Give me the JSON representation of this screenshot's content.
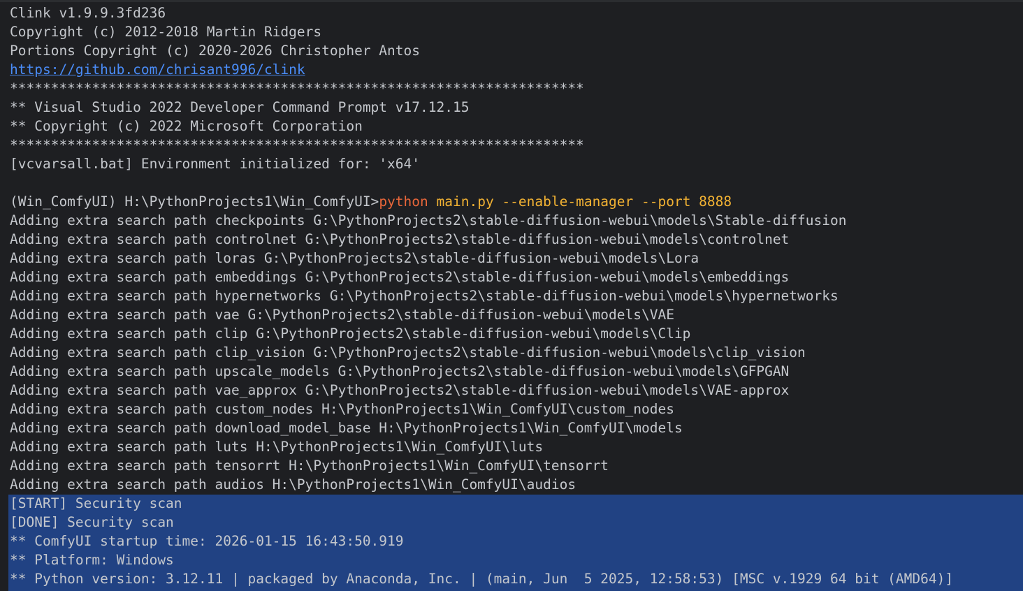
{
  "colors": {
    "background": "#1e1f22",
    "text": "#c4c7cc",
    "link": "#4a8cf7",
    "command_keyword": "#e8663a",
    "command_args": "#f2b233",
    "selection": "#214283"
  },
  "banner": {
    "clink_version": "Clink v1.9.9.3fd236",
    "clink_copyright": "Copyright (c) 2012-2018 Martin Ridgers",
    "portions_copyright": "Portions Copyright (c) 2020-2026 Christopher Antos",
    "url": "https://github.com/chrisant996/clink",
    "stars_1": "**********************************************************************",
    "vs_title": "** Visual Studio 2022 Developer Command Prompt v17.12.15",
    "vs_copyright": "** Copyright (c) 2022 Microsoft Corporation",
    "stars_2": "**********************************************************************",
    "vcvars": "[vcvarsall.bat] Environment initialized for: 'x64'"
  },
  "prompt": {
    "text": "(Win_ComfyUI) H:\\PythonProjects1\\Win_ComfyUI>",
    "command": "python",
    "args": " main.py --enable-manager --port 8888"
  },
  "output_lines": [
    "Adding extra search path checkpoints G:\\PythonProjects2\\stable-diffusion-webui\\models\\Stable-diffusion",
    "Adding extra search path controlnet G:\\PythonProjects2\\stable-diffusion-webui\\models\\controlnet",
    "Adding extra search path loras G:\\PythonProjects2\\stable-diffusion-webui\\models\\Lora",
    "Adding extra search path embeddings G:\\PythonProjects2\\stable-diffusion-webui\\models\\embeddings",
    "Adding extra search path hypernetworks G:\\PythonProjects2\\stable-diffusion-webui\\models\\hypernetworks",
    "Adding extra search path vae G:\\PythonProjects2\\stable-diffusion-webui\\models\\VAE",
    "Adding extra search path clip G:\\PythonProjects2\\stable-diffusion-webui\\models\\Clip",
    "Adding extra search path clip_vision G:\\PythonProjects2\\stable-diffusion-webui\\models\\clip_vision",
    "Adding extra search path upscale_models G:\\PythonProjects2\\stable-diffusion-webui\\models\\GFPGAN",
    "Adding extra search path vae_approx G:\\PythonProjects2\\stable-diffusion-webui\\models\\VAE-approx",
    "Adding extra search path custom_nodes H:\\PythonProjects1\\Win_ComfyUI\\custom_nodes",
    "Adding extra search path download_model_base H:\\PythonProjects1\\Win_ComfyUI\\models",
    "Adding extra search path luts H:\\PythonProjects1\\Win_ComfyUI\\luts",
    "Adding extra search path tensorrt H:\\PythonProjects1\\Win_ComfyUI\\tensorrt",
    "Adding extra search path audios H:\\PythonProjects1\\Win_ComfyUI\\audios"
  ],
  "selected_lines": [
    "[START] Security scan",
    "[DONE] Security scan",
    "** ComfyUI startup time: 2026-01-15 16:43:50.919",
    "** Platform: Windows",
    "** Python version: 3.12.11 | packaged by Anaconda, Inc. | (main, Jun  5 2025, 12:58:53) [MSC v.1929 64 bit (AMD64)]"
  ]
}
